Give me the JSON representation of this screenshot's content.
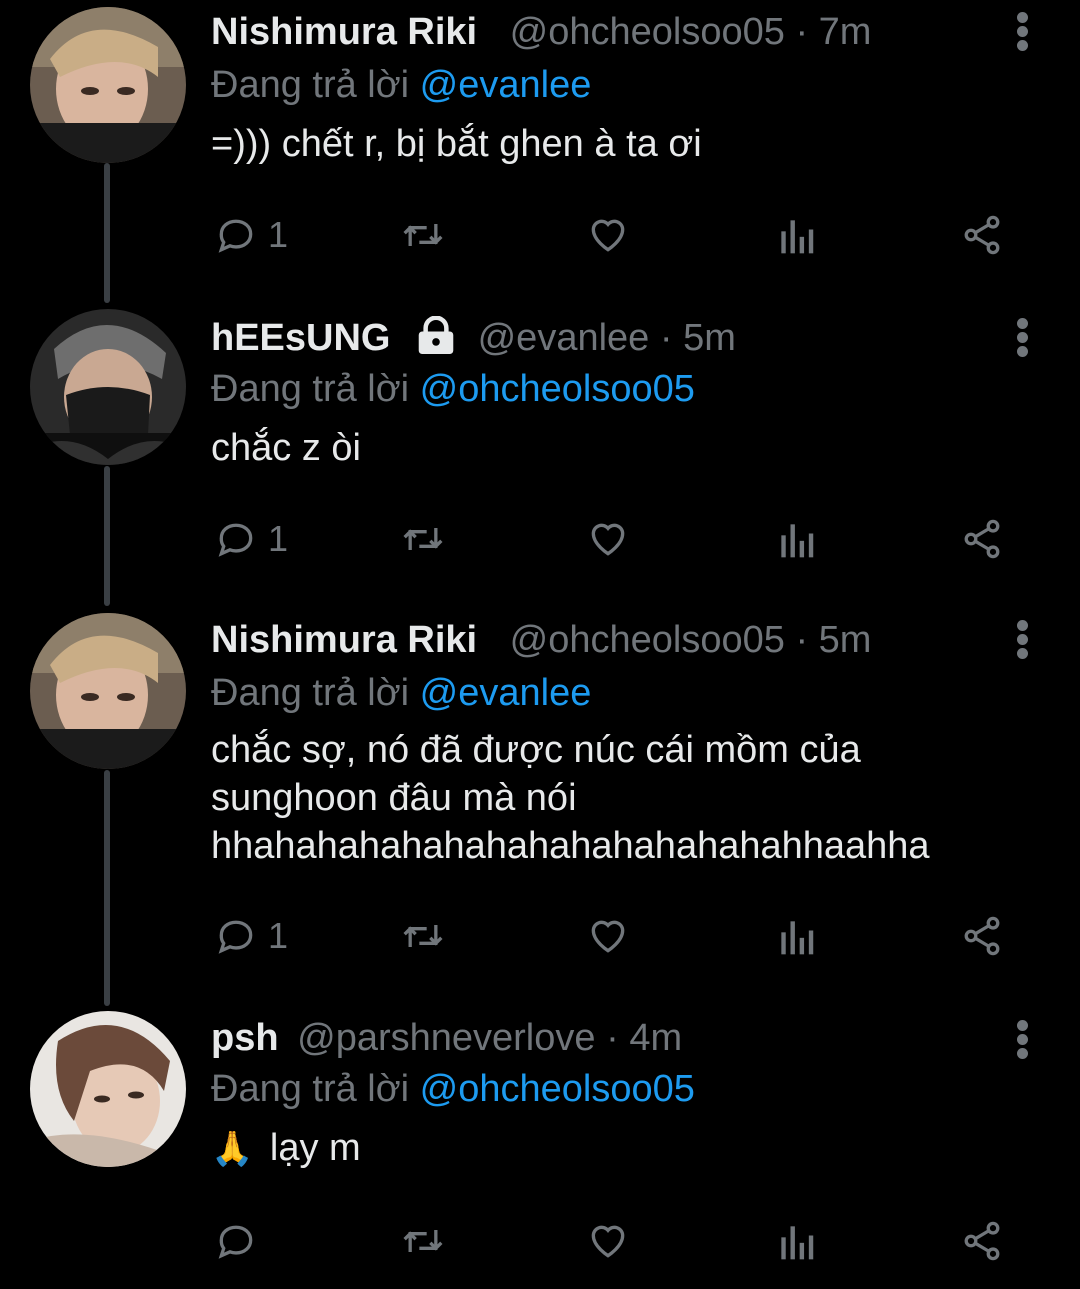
{
  "reply_prefix": "Đang trả lời",
  "colors": {
    "background": "#000000",
    "text": "#e7e9ea",
    "muted": "#71767b",
    "link": "#1d9bf0"
  },
  "tweets": [
    {
      "name": "Nishimura Riki",
      "handle": "@ohcheolsoo05",
      "separator": "·",
      "time": "7m",
      "protected": false,
      "reply_to": "@evanlee",
      "text": "=))) chết r, bị bắt ghen à ta ơi",
      "reply_count": "1",
      "avatar": "avatar-riki"
    },
    {
      "name": "hEEsUNG",
      "handle": "@evanlee",
      "separator": "·",
      "time": "5m",
      "protected": true,
      "reply_to": "@ohcheolsoo05",
      "text": "chắc z òi",
      "reply_count": "1",
      "avatar": "avatar-heesung"
    },
    {
      "name": "Nishimura Riki",
      "handle": "@ohcheolsoo05",
      "separator": "·",
      "time": "5m",
      "protected": false,
      "reply_to": "@evanlee",
      "text_lines": [
        "chắc sợ, nó đã được núc cái mồm của",
        "sunghoon đâu mà nói",
        "hhahahahahahahahahahahahahahhaahha"
      ],
      "reply_count": "1",
      "avatar": "avatar-riki"
    },
    {
      "name": "psh",
      "handle": "@parshneverlove",
      "separator": "·",
      "time": "4m",
      "protected": false,
      "reply_to": "@ohcheolsoo05",
      "emoji": "🙏",
      "text": "lạy m",
      "reply_count": "",
      "avatar": "avatar-psh"
    }
  ],
  "icons": [
    "reply-icon",
    "retweet-icon",
    "like-icon",
    "views-icon",
    "share-icon",
    "more-icon",
    "lock-icon"
  ]
}
